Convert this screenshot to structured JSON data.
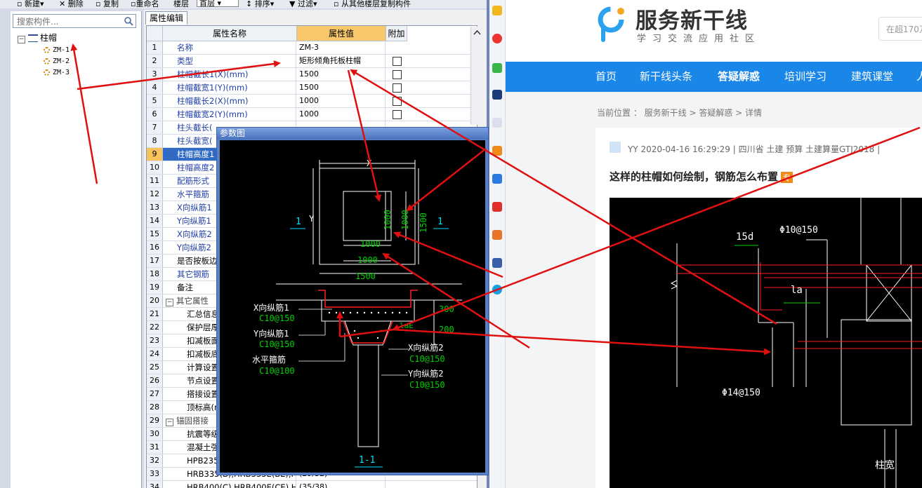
{
  "toolbar": {
    "new_label": "新建",
    "delete_label": "删除",
    "copy_label": "复制",
    "rename_label": "重命名",
    "floor_label": "楼层",
    "floor_value": "首层",
    "sort_label": "排序",
    "filter_label": "过滤",
    "copy_from_label": "从其他楼层复制构件"
  },
  "tree": {
    "search_placeholder": "搜索构件...",
    "root_label": "柱帽",
    "leaves": [
      "ZM-1",
      "ZM-2",
      "ZM-3"
    ],
    "selected_leaf": "ZM-3"
  },
  "panel": {
    "tab_label": "属性编辑",
    "headers": {
      "name": "属性名称",
      "value": "属性值",
      "extra": "附加"
    },
    "rows": [
      {
        "n": "1",
        "name": "名称",
        "value": "ZM-3",
        "cb": false
      },
      {
        "n": "2",
        "name": "类型",
        "value": "矩形倾角托板柱帽",
        "cb": true
      },
      {
        "n": "3",
        "name": "柱帽截长1(X)(mm)",
        "value": "1500",
        "cb": true
      },
      {
        "n": "4",
        "name": "柱帽截宽1(Y)(mm)",
        "value": "1500",
        "cb": true
      },
      {
        "n": "5",
        "name": "柱帽截长2(X)(mm)",
        "value": "1000",
        "cb": true
      },
      {
        "n": "6",
        "name": "柱帽截宽2(Y)(mm)",
        "value": "1000",
        "cb": true
      },
      {
        "n": "7",
        "name": "柱头截长(",
        "value": "",
        "cb": false
      },
      {
        "n": "8",
        "name": "柱头截宽(",
        "value": "",
        "cb": false
      },
      {
        "n": "9",
        "name": "柱帽高度1",
        "value": "",
        "cb": false
      },
      {
        "n": "10",
        "name": "柱帽高度2",
        "value": "",
        "cb": false
      },
      {
        "n": "11",
        "name": "配筋形式",
        "value": "",
        "cb": false
      },
      {
        "n": "12",
        "name": "水平箍筋",
        "value": "",
        "cb": false
      },
      {
        "n": "13",
        "name": "X向纵筋1",
        "value": "",
        "cb": false
      },
      {
        "n": "14",
        "name": "Y向纵筋1",
        "value": "",
        "cb": false
      },
      {
        "n": "15",
        "name": "X向纵筋2",
        "value": "",
        "cb": false
      },
      {
        "n": "16",
        "name": "Y向纵筋2",
        "value": "",
        "cb": false
      },
      {
        "n": "17",
        "name": "是否按板边",
        "value": "",
        "cb": false
      },
      {
        "n": "18",
        "name": "其它钢筋",
        "value": "",
        "cb": false
      },
      {
        "n": "19",
        "name": "备注",
        "value": "",
        "cb": false
      },
      {
        "n": "20",
        "name": "其它属性",
        "value": "",
        "cb": false
      },
      {
        "n": "21",
        "name": "汇总信息",
        "value": "",
        "cb": false
      },
      {
        "n": "22",
        "name": "保护层厚",
        "value": "",
        "cb": false
      },
      {
        "n": "23",
        "name": "扣减板面",
        "value": "",
        "cb": false
      },
      {
        "n": "24",
        "name": "扣减板底",
        "value": "",
        "cb": false
      },
      {
        "n": "25",
        "name": "计算设置",
        "value": "",
        "cb": false
      },
      {
        "n": "26",
        "name": "节点设置",
        "value": "",
        "cb": false
      },
      {
        "n": "27",
        "name": "搭接设置",
        "value": "",
        "cb": false
      },
      {
        "n": "28",
        "name": "顶标高(m",
        "value": "",
        "cb": false
      },
      {
        "n": "29",
        "name": "锚固搭接",
        "value": "",
        "cb": false
      },
      {
        "n": "30",
        "name": "抗震等级",
        "value": "",
        "cb": false
      },
      {
        "n": "31",
        "name": "混凝土强",
        "value": "",
        "cb": false
      },
      {
        "n": "32",
        "name": "HPB235(A",
        "value": "",
        "cb": false
      },
      {
        "n": "33",
        "name": "HRB335(B),HRB335E(BE),HRBF",
        "value": "(29/32)",
        "cb": false
      },
      {
        "n": "34",
        "name": "HRB400(C),HRB400E(CE),HRBF",
        "value": "(35/38)",
        "cb": false
      }
    ]
  },
  "dialog": {
    "title": "参数图",
    "plan": {
      "x_label": "X",
      "y_label": "Y",
      "section_mark": "1",
      "dims": [
        "1000",
        "1000",
        "1500",
        "1000",
        "1000",
        "1500"
      ]
    },
    "section": {
      "x_bar1_label": "X向纵筋1",
      "x_bar1_spec": "C10@150",
      "y_bar1_label": "Y向纵筋1",
      "y_bar1_spec": "C10@150",
      "stirrup_label": "水平箍筋",
      "stirrup_spec": "C10@100",
      "x_bar2_label": "X向纵筋2",
      "x_bar2_spec": "C10@150",
      "y_bar2_label": "Y向纵筋2",
      "y_bar2_spec": "C10@150",
      "h1": "300",
      "h2": "200",
      "lae": "laE",
      "section_title": "1-1"
    }
  },
  "web": {
    "logo_text": "服务新干线",
    "logo_sub": "学习交流应用社区",
    "search_placeholder": "在超170万",
    "nav": [
      "首页",
      "新干线头条",
      "答疑解惑",
      "培训学习",
      "建筑课堂",
      "人"
    ],
    "nav_active": "答疑解惑",
    "breadcrumb": "当前位置 ： 服务新干线 > 答疑解惑 > 详情",
    "meta": "YY    2020-04-16 16:29:29    |    四川省  土建 预算 土建算量GTJ2018    |",
    "question_title": "这样的柱帽如何绘制，钢筋怎么布置",
    "question_badge": "专",
    "drawing": {
      "l1": "15d",
      "l2": "Φ10@150",
      "l3": "la",
      "l4": "Φ14@150",
      "l5": "柱宽"
    }
  },
  "colors": {
    "nav_blue": "#1a86e8",
    "select_blue": "#316ac5",
    "highlight_orange": "#f6c35a",
    "arrow_red": "#e01010",
    "cad_green": "#00d000",
    "cad_cyan": "#00e0ff"
  }
}
